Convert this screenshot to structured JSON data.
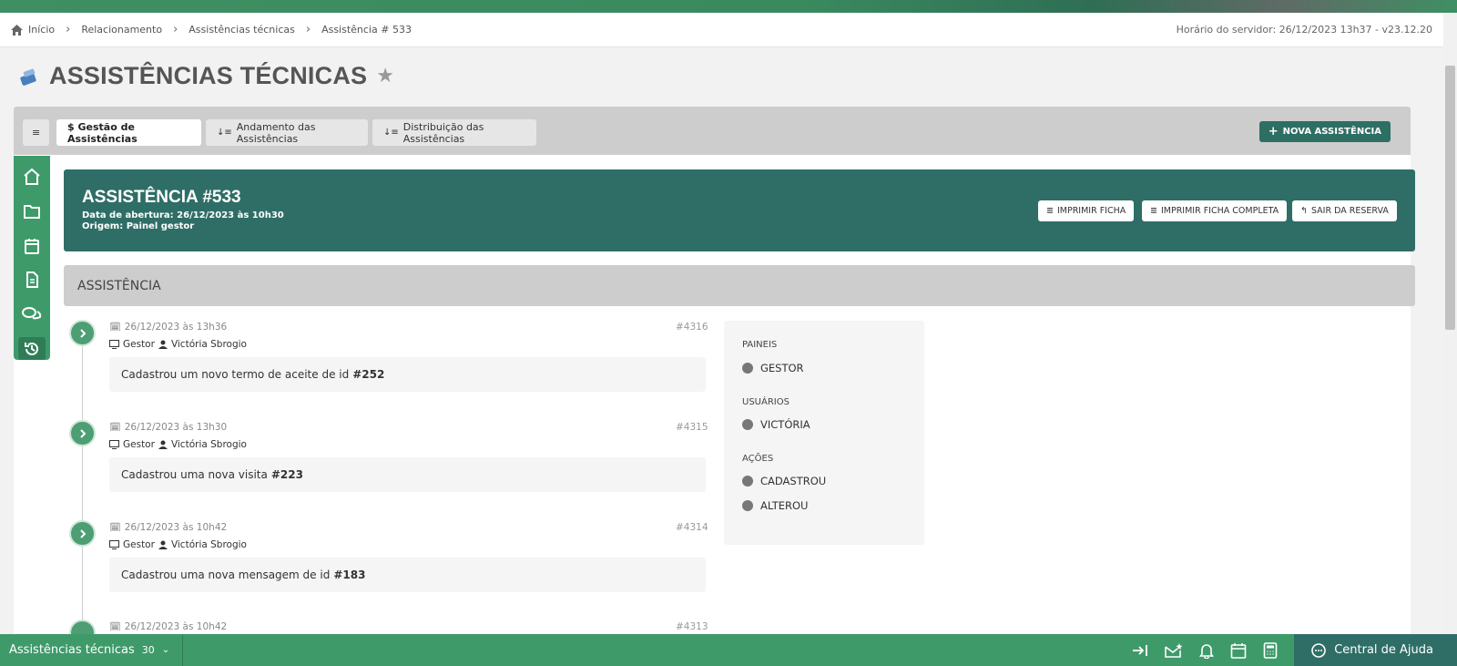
{
  "breadcrumb": {
    "items": [
      "Início",
      "Relacionamento",
      "Assistências técnicas",
      "Assistência # 533"
    ],
    "server_time": "Horário do servidor: 26/12/2023 13h37 - v23.12.20"
  },
  "page": {
    "title": "ASSISTÊNCIAS TÉCNICAS"
  },
  "tabs": {
    "menu_icon": "≡",
    "items": [
      {
        "label": "$ Gestão de Assistências"
      },
      {
        "label": "Andamento das Assistências"
      },
      {
        "label": "Distribuição das Assistências"
      }
    ],
    "new_button": "NOVA ASSISTÊNCIA"
  },
  "header": {
    "title": "ASSISTÊNCIA #533",
    "opened": "Data de abertura: 26/12/2023 às 10h30",
    "origin": "Origem: Painel gestor",
    "buttons": {
      "print": "IMPRIMIR FICHA",
      "print_full": "IMPRIMIR FICHA COMPLETA",
      "leave": "SAIR DA RESERVA"
    }
  },
  "section": {
    "title": "ASSISTÊNCIA"
  },
  "timeline": [
    {
      "date": "26/12/2023 às 13h36",
      "id": "#4316",
      "panel": "Gestor",
      "user": "Victória Sbrogio",
      "text": "Cadastrou um novo termo de aceite de id",
      "ref": "#252"
    },
    {
      "date": "26/12/2023 às 13h30",
      "id": "#4315",
      "panel": "Gestor",
      "user": "Victória Sbrogio",
      "text": "Cadastrou uma nova visita",
      "ref": "#223"
    },
    {
      "date": "26/12/2023 às 10h42",
      "id": "#4314",
      "panel": "Gestor",
      "user": "Victória Sbrogio",
      "text": "Cadastrou uma nova mensagem de id",
      "ref": "#183"
    },
    {
      "date": "26/12/2023 às 10h42",
      "id": "#4313"
    }
  ],
  "filters": {
    "panels_head": "PAINEIS",
    "panels": [
      "GESTOR"
    ],
    "users_head": "USUÁRIOS",
    "users": [
      "VICTÓRIA"
    ],
    "actions_head": "AÇÕES",
    "actions": [
      "CADASTROU",
      "ALTEROU"
    ]
  },
  "bottombar": {
    "module": "Assistências técnicas",
    "count": "30",
    "help": "Central de Ajuda"
  },
  "colors": {
    "brand": "#3f9a6a",
    "header": "#2f6e66",
    "accent_dark": "#2f7d56"
  }
}
